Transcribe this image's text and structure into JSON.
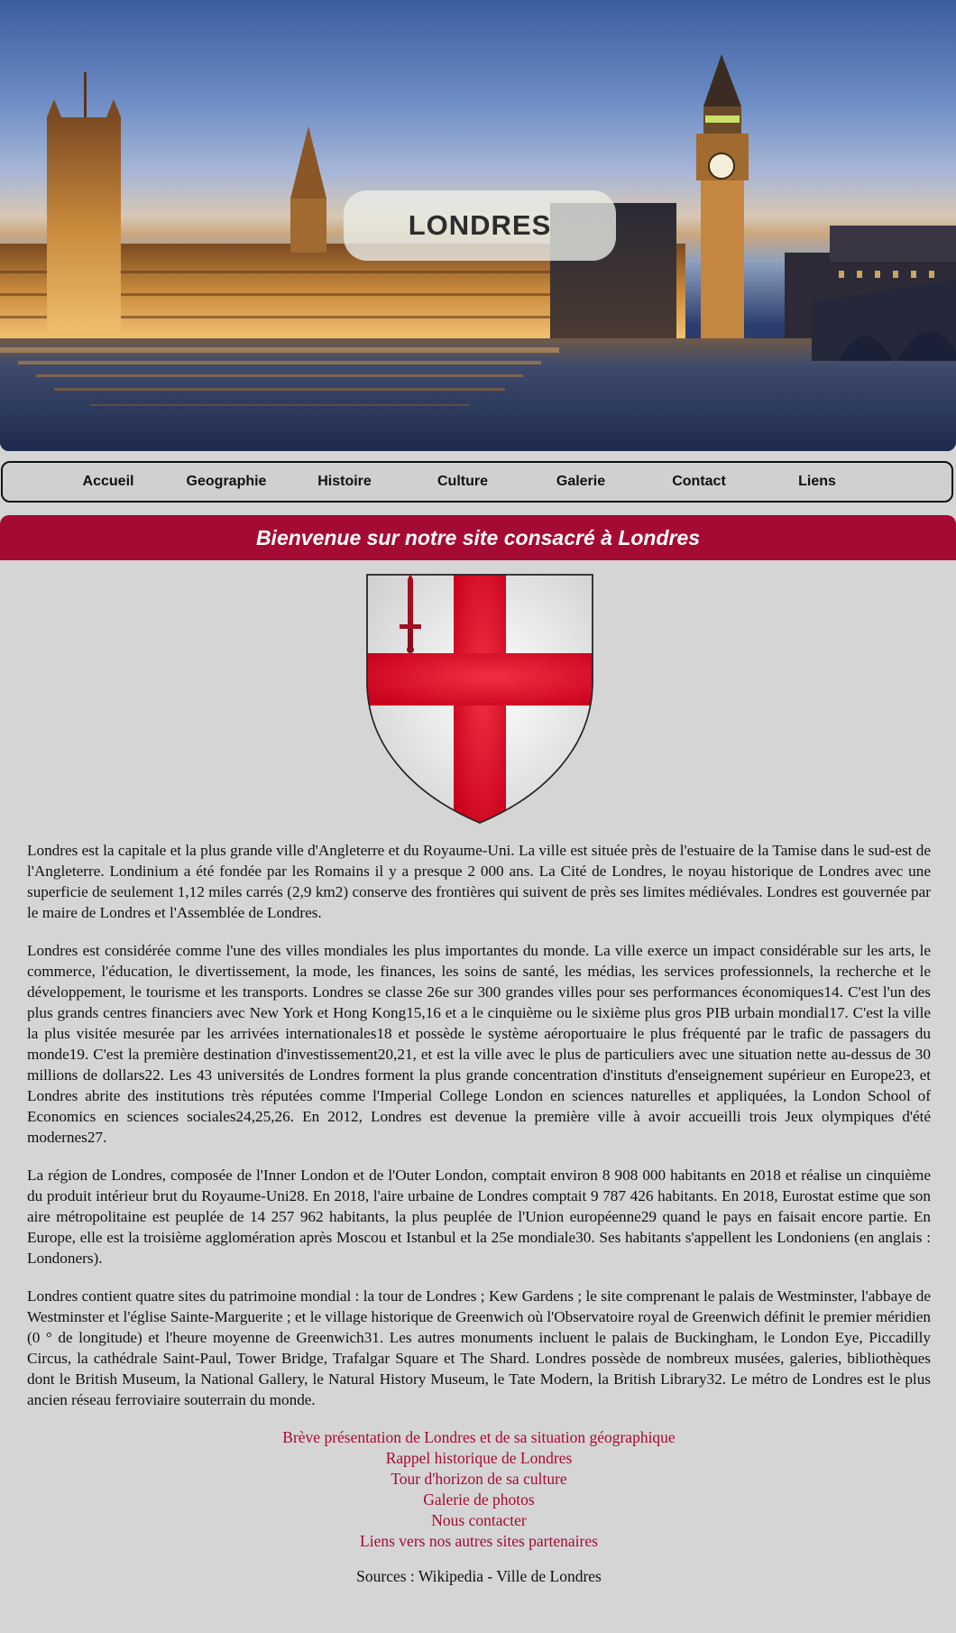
{
  "hero": {
    "title": "LONDRES"
  },
  "nav": {
    "items": [
      {
        "label": "Accueil"
      },
      {
        "label": "Geographie"
      },
      {
        "label": "Histoire"
      },
      {
        "label": "Culture"
      },
      {
        "label": "Galerie"
      },
      {
        "label": "Contact"
      },
      {
        "label": "Liens"
      }
    ]
  },
  "banner": {
    "title": "Bienvenue sur notre site consacré à Londres"
  },
  "crest": {
    "icon": "coat-of-arms-icon"
  },
  "paragraphs": [
    "Londres est la capitale et la plus grande ville d'Angleterre et du Royaume-Uni. La ville est située près de l'estuaire de la Tamise dans le sud-est de l'Angleterre. Londinium a été fondée par les Romains il y a presque 2 000 ans. La Cité de Londres, le noyau historique de Londres avec une superficie de seulement 1,12 miles carrés (2,9 km2) conserve des frontières qui suivent de près ses limites médiévales. Londres est gouvernée par le maire de Londres et l'Assemblée de Londres.",
    "Londres est considérée comme l'une des villes mondiales les plus importantes du monde. La ville exerce un impact considérable sur les arts, le commerce, l'éducation, le divertissement, la mode, les finances, les soins de santé, les médias, les services professionnels, la recherche et le développement, le tourisme et les transports. Londres se classe 26e sur 300 grandes villes pour ses performances économiques14. C'est l'un des plus grands centres financiers avec New York et Hong Kong15,16 et a le cinquième ou le sixième plus gros PIB urbain mondial17. C'est la ville la plus visitée mesurée par les arrivées internationales18 et possède le système aéroportuaire le plus fréquenté par le trafic de passagers du monde19. C'est la première destination d'investissement20,21, et est la ville avec le plus de particuliers avec une situation nette au-dessus de 30 millions de dollars22. Les 43 universités de Londres forment la plus grande concentration d'instituts d'enseignement supérieur en Europe23, et Londres abrite des institutions très réputées comme l'Imperial College London en sciences naturelles et appliquées, la London School of Economics en sciences sociales24,25,26. En 2012, Londres est devenue la première ville à avoir accueilli trois Jeux olympiques d'été modernes27.",
    "La région de Londres, composée de l'Inner London et de l'Outer London, comptait environ 8 908 000 habitants en 2018 et réalise un cinquième du produit intérieur brut du Royaume-Uni28. En 2018, l'aire urbaine de Londres comptait 9 787 426 habitants. En 2018, Eurostat estime que son aire métropolitaine est peuplée de 14 257 962 habitants, la plus peuplée de l'Union européenne29 quand le pays en faisait encore partie. En Europe, elle est la troisième agglomération après Moscou et Istanbul et la 25e mondiale30. Ses habitants s'appellent les Londoniens (en anglais : Londoners).",
    "Londres contient quatre sites du patrimoine mondial : la tour de Londres ; Kew Gardens ; le site comprenant le palais de Westminster, l'abbaye de Westminster et l'église Sainte-Marguerite ; et le village historique de Greenwich où l'Observatoire royal de Greenwich définit le premier méridien (0 ° de longitude) et l'heure moyenne de Greenwich31. Les autres monuments incluent le palais de Buckingham, le London Eye, Piccadilly Circus, la cathédrale Saint-Paul, Tower Bridge, Trafalgar Square et The Shard. Londres possède de nombreux musées, galeries, bibliothèques dont le British Museum, la National Gallery, le Natural History Museum, le Tate Modern, la British Library32. Le métro de Londres est le plus ancien réseau ferroviaire souterrain du monde."
  ],
  "links": [
    {
      "label": "Brève présentation de Londres et de sa situation géographique"
    },
    {
      "label": "Rappel historique de Londres"
    },
    {
      "label": "Tour d'horizon de sa culture"
    },
    {
      "label": "Galerie de photos"
    },
    {
      "label": "Nous contacter"
    },
    {
      "label": "Liens vers nos autres sites partenaires"
    }
  ],
  "sources": "Sources : Wikipedia - Ville de Londres",
  "colors": {
    "accent": "#a50a33",
    "background": "#d5d5d5"
  }
}
